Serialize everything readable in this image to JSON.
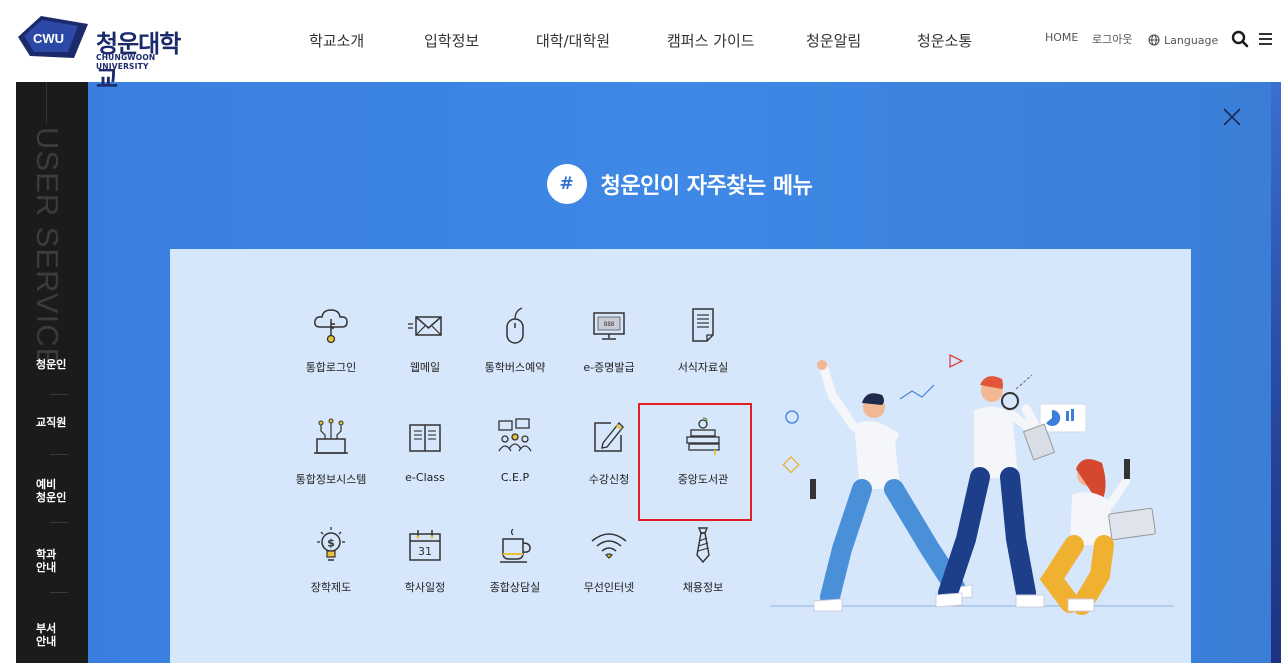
{
  "header": {
    "logo_badge": "CWU",
    "logo_ko": "청운대학교",
    "logo_en": "CHUNGWOON UNIVERSITY",
    "nav": [
      "학교소개",
      "입학정보",
      "대학/대학원",
      "캠퍼스 가이드",
      "청운알림",
      "청운소통"
    ],
    "util": {
      "home": "HOME",
      "logout": "로그아웃",
      "language": "Language"
    },
    "icons": {
      "search": "search-icon",
      "menu": "menu-icon"
    }
  },
  "sidebar": {
    "title": "USER SERVICE",
    "items": [
      {
        "label": "청운인",
        "active": true
      },
      {
        "label": "교직원"
      },
      {
        "label": "예비\n청운인"
      },
      {
        "label": "학과\n안내"
      },
      {
        "label": "부서\n안내"
      }
    ]
  },
  "modal": {
    "hash": "#",
    "title": "청운인이 자주찾는 메뉴",
    "close_icon": "close-icon",
    "menu": [
      {
        "label": "통합로그인",
        "icon": "cloud-key-icon"
      },
      {
        "label": "웹메일",
        "icon": "mail-icon"
      },
      {
        "label": "통학버스예약",
        "icon": "mouse-icon"
      },
      {
        "label": "e-증명발급",
        "icon": "monitor-icon"
      },
      {
        "label": "서식자료실",
        "icon": "document-icon"
      },
      {
        "label": "통합정보시스템",
        "icon": "network-icon"
      },
      {
        "label": "e-Class",
        "icon": "book-icon"
      },
      {
        "label": "C.E.P",
        "icon": "people-chat-icon"
      },
      {
        "label": "수강신청",
        "icon": "edit-icon"
      },
      {
        "label": "중앙도서관",
        "icon": "library-icon"
      },
      {
        "label": "장학제도",
        "icon": "bulb-dollar-icon"
      },
      {
        "label": "학사일정",
        "icon": "calendar-icon"
      },
      {
        "label": "종합상담실",
        "icon": "coffee-icon"
      },
      {
        "label": "무선인터넷",
        "icon": "wifi-icon"
      },
      {
        "label": "채용정보",
        "icon": "tie-icon"
      }
    ],
    "calendar_day": "31"
  },
  "colors": {
    "brand_navy": "#1b2a6b",
    "modal_blue": "#3e88e6",
    "panel_bg": "#d6e6fb",
    "highlight_red": "#e02020",
    "sidebar_bg": "#1b1b1b"
  }
}
